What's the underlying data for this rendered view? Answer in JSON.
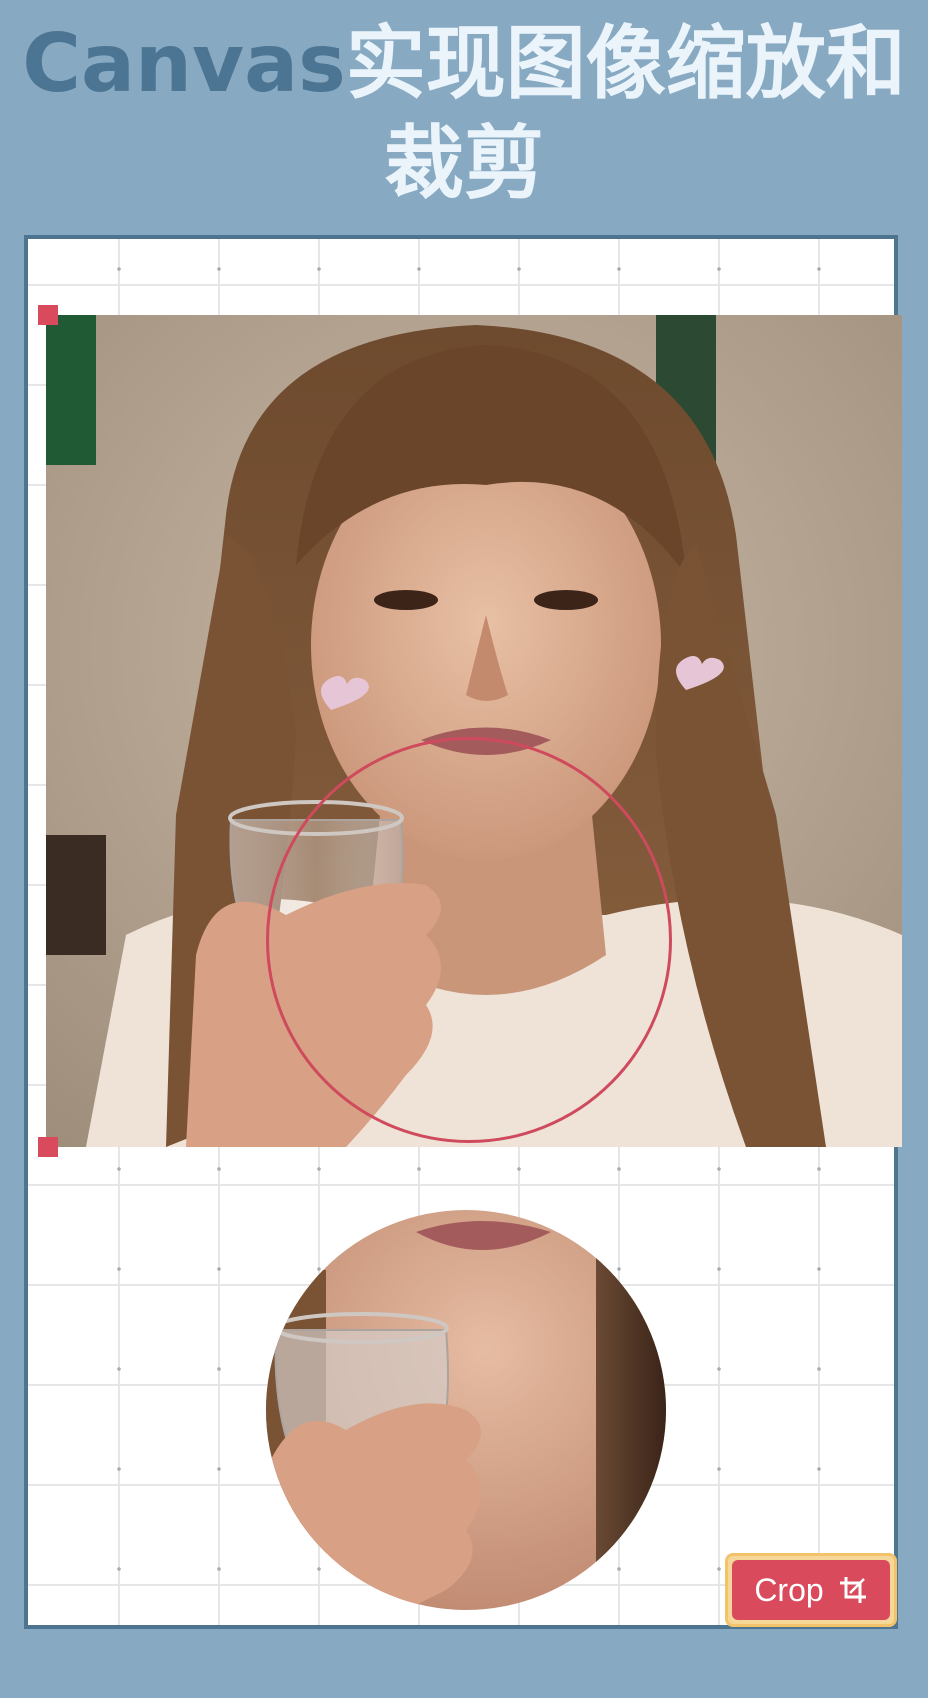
{
  "header": {
    "title_accent": "Canvas",
    "title_rest": "实现图像缩放和裁剪"
  },
  "editor": {
    "crop_button_label": "Crop",
    "crop_icon": "crop-icon",
    "handle_color": "#d94a5c",
    "crop_circle_color": "#cf4a5d"
  },
  "colors": {
    "background": "#87a9c2",
    "frame_border": "#4e7590",
    "title_accent": "#4c7593",
    "title_text": "#eaf4fa",
    "button": "#d94a5c"
  }
}
